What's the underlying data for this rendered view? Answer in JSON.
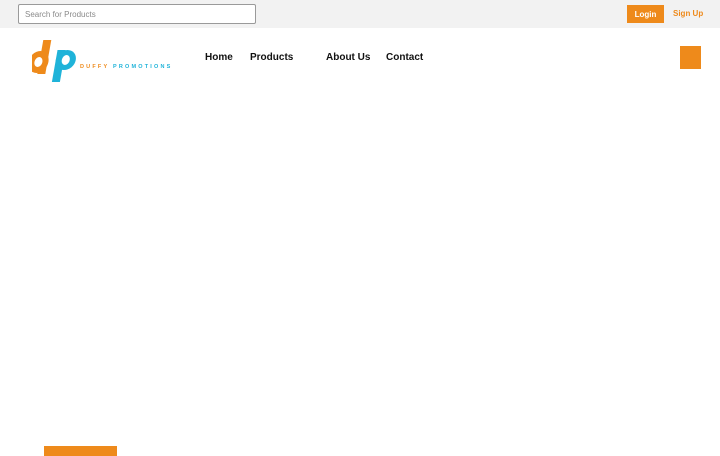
{
  "topbar": {
    "search": {
      "placeholder": "Search for Products",
      "value": ""
    },
    "login_label": "Login",
    "signup_label": "Sign Up"
  },
  "brand": {
    "tagline": "DUFFY PROMOTIONS",
    "colors": {
      "orange": "#ee8a1b",
      "cyan": "#1fb3d9"
    }
  },
  "nav": {
    "home": "Home",
    "products": "Products",
    "about": "About Us",
    "contact": "Contact"
  },
  "icons": {
    "menu": "hamburger-menu-icon"
  }
}
